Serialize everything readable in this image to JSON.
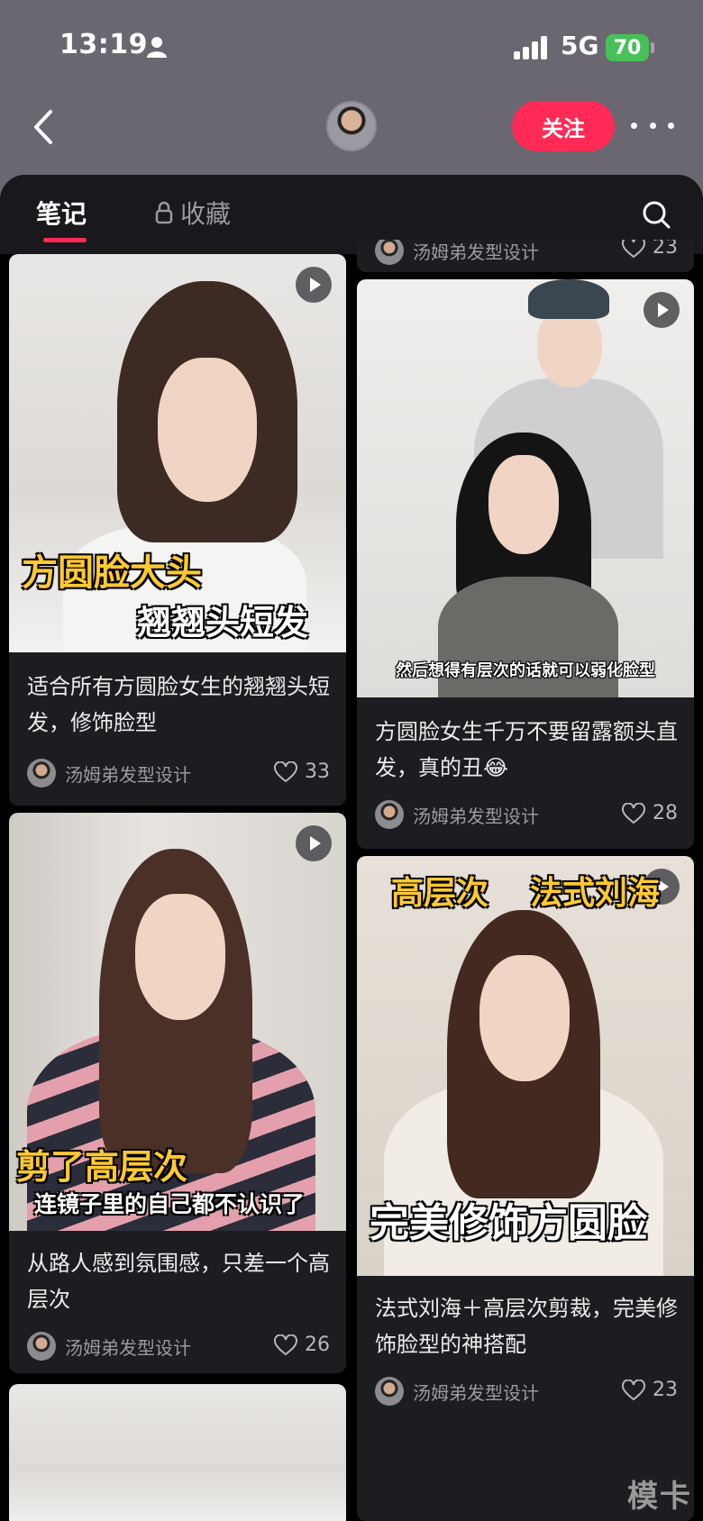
{
  "status": {
    "time": "13:19",
    "network": "5G",
    "battery": "70"
  },
  "nav": {
    "follow_label": "关注"
  },
  "tabs": {
    "notes": "笔记",
    "favorites": "收藏"
  },
  "partial_top": {
    "author": "汤姆弟发型设计",
    "likes": "23"
  },
  "cards": [
    {
      "overlay_1": "方圆脸大头",
      "overlay_2": "翘翘头短发",
      "title": "适合所有方圆脸女生的翘翘头短发，修饰脸型",
      "author": "汤姆弟发型设计",
      "likes": "33"
    },
    {
      "caption": "然后想得有层次的话就可以弱化脸型",
      "title": "方圆脸女生千万不要留露额头直发，真的丑😂",
      "author": "汤姆弟发型设计",
      "likes": "28"
    },
    {
      "overlay_1": "剪了高层次",
      "overlay_2": "连镜子里的自己都不认识了",
      "title": "从路人感到氛围感，只差一个高层次",
      "author": "汤姆弟发型设计",
      "likes": "26"
    },
    {
      "overlay_1": "高层次",
      "overlay_2": "法式刘海",
      "overlay_3": "完美修饰方圆脸",
      "title": "法式刘海＋高层次剪裁，完美修饰脸型的神搭配",
      "author": "汤姆弟发型设计",
      "likes": "23"
    }
  ],
  "watermark": "模卡",
  "icons": {
    "back": "chevron-left-icon",
    "more": "more-dots-icon",
    "lock": "lock-icon",
    "search": "search-icon",
    "heart": "heart-icon",
    "play": "play-icon",
    "person": "person-icon",
    "signal": "signal-icon"
  },
  "colors": {
    "accent": "#ff2a55",
    "overlay_yellow": "#ffc933",
    "battery": "#47c058"
  }
}
